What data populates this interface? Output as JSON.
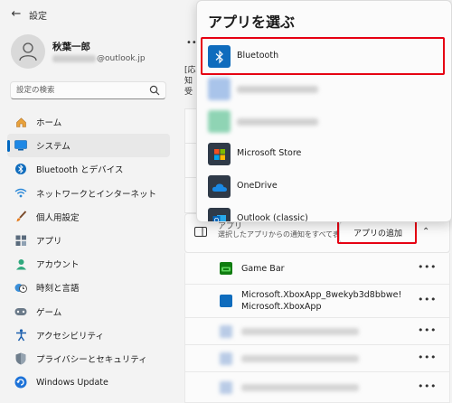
{
  "window": {
    "title": "設定",
    "controls": {
      "minimize": "—",
      "maximize": "☐",
      "close": "✕"
    }
  },
  "profile": {
    "name": "秋葉一郎",
    "email_suffix": "@outlook.jp"
  },
  "search": {
    "placeholder": "設定の検索"
  },
  "nav": [
    {
      "label": "ホーム",
      "icon": "home-icon"
    },
    {
      "label": "システム",
      "icon": "system-icon",
      "selected": true
    },
    {
      "label": "Bluetooth とデバイス",
      "icon": "bluetooth-icon"
    },
    {
      "label": "ネットワークとインターネット",
      "icon": "wifi-icon"
    },
    {
      "label": "個人用設定",
      "icon": "brush-icon"
    },
    {
      "label": "アプリ",
      "icon": "apps-icon"
    },
    {
      "label": "アカウント",
      "icon": "account-icon"
    },
    {
      "label": "時刻と言語",
      "icon": "clock-globe-icon"
    },
    {
      "label": "ゲーム",
      "icon": "gamepad-icon"
    },
    {
      "label": "アクセシビリティ",
      "icon": "accessibility-icon"
    },
    {
      "label": "プライバシーとセキュリティ",
      "icon": "shield-icon"
    },
    {
      "label": "Windows Update",
      "icon": "update-icon"
    }
  ],
  "main": {
    "hint_lines": [
      "[応",
      "知",
      "受"
    ],
    "dots": "••",
    "add_section": {
      "title": "アプリ",
      "description": "選択したアプリからの通知をすべて表示する",
      "button_label": "アプリの追加"
    },
    "apps": [
      {
        "name": "Game Bar",
        "icon": "game-bar-icon"
      },
      {
        "name": "Microsoft.XboxApp_8wekyb3d8bbwe!\nMicrosoft.XboxApp",
        "icon": "xbox-app-icon"
      }
    ],
    "more_label": "•••"
  },
  "popup": {
    "title": "アプリを選ぶ",
    "items": [
      {
        "label": "Bluetooth",
        "icon": "bluetooth-app-icon"
      },
      {
        "label": "Microsoft Store",
        "icon": "microsoft-store-icon"
      },
      {
        "label": "OneDrive",
        "icon": "onedrive-icon"
      },
      {
        "label": "Outlook (classic)",
        "icon": "outlook-icon"
      }
    ]
  },
  "colors": {
    "accent": "#0067c0",
    "highlight_outline": "#e60012",
    "bluetooth_tile": "#0f6cbd"
  }
}
